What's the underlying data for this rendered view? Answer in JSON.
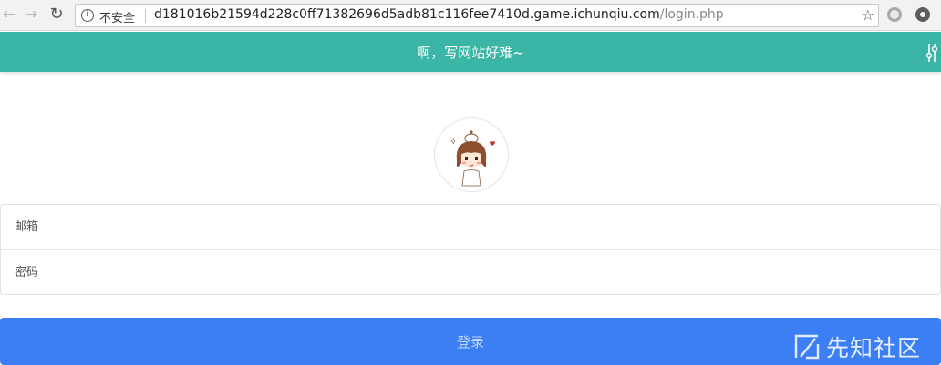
{
  "browser": {
    "security_label": "不安全",
    "url_host": "d181016b21594d228c0ff71382696d5adb81c116fee7410d.game.ichunqiu.com",
    "url_path": "/login.php"
  },
  "header": {
    "title": "啊，写网站好难~",
    "bg_color": "#3bb5a5"
  },
  "form": {
    "email_placeholder": "邮箱",
    "password_placeholder": "密码",
    "login_label": "登录",
    "button_color": "#3c7ff5"
  },
  "watermark": {
    "text": "先知社区"
  }
}
